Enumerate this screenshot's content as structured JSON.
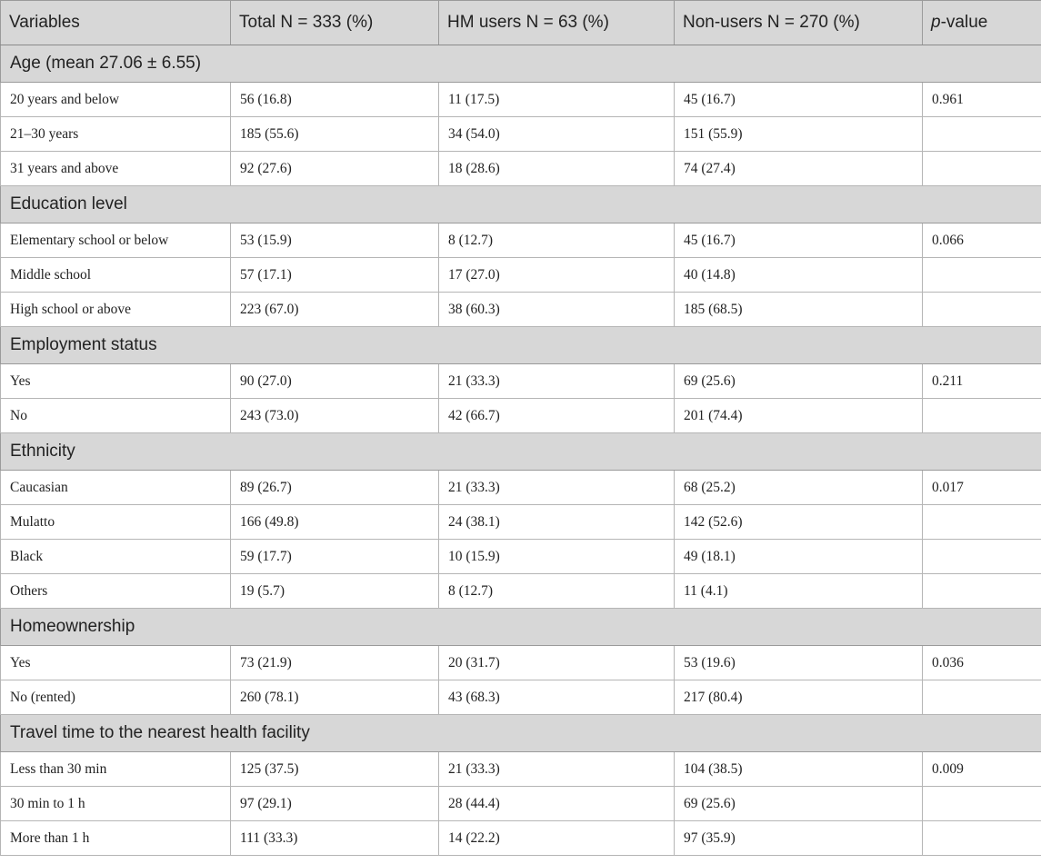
{
  "header": {
    "variables": "Variables",
    "total": "Total N = 333 (%)",
    "hm_users": "HM users N = 63 (%)",
    "non_users": "Non-users N = 270 (%)",
    "p_italic": "p",
    "p_rest": "-value"
  },
  "sections": [
    {
      "title": "Age (mean 27.06 ± 6.55)",
      "rows": [
        {
          "label": "20 years and below",
          "total": "56 (16.8)",
          "hm": "11 (17.5)",
          "non": "45 (16.7)",
          "p": "0.961"
        },
        {
          "label": "21–30 years",
          "total": "185 (55.6)",
          "hm": "34 (54.0)",
          "non": "151 (55.9)",
          "p": ""
        },
        {
          "label": "31 years and above",
          "total": "92 (27.6)",
          "hm": "18 (28.6)",
          "non": "74 (27.4)",
          "p": ""
        }
      ]
    },
    {
      "title": "Education level",
      "rows": [
        {
          "label": "Elementary school or below",
          "total": "53 (15.9)",
          "hm": "8 (12.7)",
          "non": "45 (16.7)",
          "p": "0.066"
        },
        {
          "label": "Middle school",
          "total": "57 (17.1)",
          "hm": "17 (27.0)",
          "non": "40 (14.8)",
          "p": ""
        },
        {
          "label": "High school or above",
          "total": "223 (67.0)",
          "hm": "38 (60.3)",
          "non": "185 (68.5)",
          "p": ""
        }
      ]
    },
    {
      "title": "Employment status",
      "rows": [
        {
          "label": "Yes",
          "total": "90 (27.0)",
          "hm": "21 (33.3)",
          "non": "69 (25.6)",
          "p": "0.211"
        },
        {
          "label": "No",
          "total": "243 (73.0)",
          "hm": "42 (66.7)",
          "non": "201 (74.4)",
          "p": ""
        }
      ]
    },
    {
      "title": "Ethnicity",
      "rows": [
        {
          "label": "Caucasian",
          "total": "89 (26.7)",
          "hm": "21 (33.3)",
          "non": "68 (25.2)",
          "p": "0.017"
        },
        {
          "label": "Mulatto",
          "total": "166 (49.8)",
          "hm": "24 (38.1)",
          "non": "142 (52.6)",
          "p": ""
        },
        {
          "label": "Black",
          "total": "59 (17.7)",
          "hm": "10 (15.9)",
          "non": "49 (18.1)",
          "p": ""
        },
        {
          "label": "Others",
          "total": "19 (5.7)",
          "hm": "8 (12.7)",
          "non": "11 (4.1)",
          "p": ""
        }
      ]
    },
    {
      "title": "Homeownership",
      "rows": [
        {
          "label": "Yes",
          "total": "73 (21.9)",
          "hm": "20 (31.7)",
          "non": "53 (19.6)",
          "p": "0.036"
        },
        {
          "label": "No (rented)",
          "total": "260 (78.1)",
          "hm": "43 (68.3)",
          "non": "217 (80.4)",
          "p": ""
        }
      ]
    },
    {
      "title": "Travel time to the nearest health facility",
      "rows": [
        {
          "label": "Less than 30 min",
          "total": "125 (37.5)",
          "hm": "21 (33.3)",
          "non": "104 (38.5)",
          "p": "0.009"
        },
        {
          "label": "30 min to 1 h",
          "total": "97 (29.1)",
          "hm": "28 (44.4)",
          "non": "69 (25.6)",
          "p": ""
        },
        {
          "label": "More than 1 h",
          "total": "111 (33.3)",
          "hm": "14 (22.2)",
          "non": "97 (35.9)",
          "p": ""
        }
      ]
    }
  ]
}
